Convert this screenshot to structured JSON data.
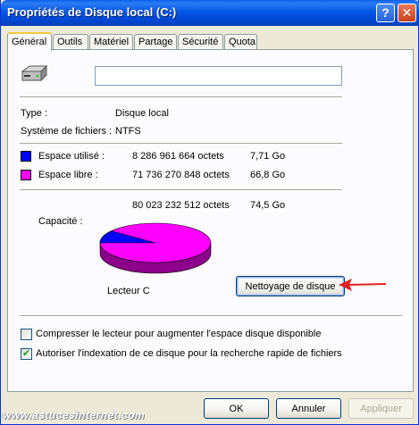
{
  "window": {
    "title": "Propriétés de Disque local (C:)"
  },
  "titlebar": {
    "help_label": "?",
    "close_label": "✕"
  },
  "tabs": [
    {
      "label": "Général",
      "active": true
    },
    {
      "label": "Outils"
    },
    {
      "label": "Matériel"
    },
    {
      "label": "Partage"
    },
    {
      "label": "Sécurité"
    },
    {
      "label": "Quota"
    }
  ],
  "drive": {
    "name_value": "",
    "icon": "hard-drive-icon"
  },
  "props": {
    "type_label": "Type :",
    "type_value": "Disque local",
    "fs_label": "Système de fichiers :",
    "fs_value": "NTFS"
  },
  "space": {
    "used_label": "Espace utilisé :",
    "used_bytes": "8 286 961 664 octets",
    "used_gb": "7,71 Go",
    "used_color": "#0000ff",
    "free_label": "Espace libre :",
    "free_bytes": "71 736 270 848 octets",
    "free_gb": "66,8 Go",
    "free_color": "#ff00ff",
    "capacity_label": "Capacité :",
    "capacity_bytes": "80 023 232 512 octets",
    "capacity_gb": "74,5 Go",
    "drive_label": "Lecteur C",
    "used_fraction": 0.1036
  },
  "cleanup_button": "Nettoyage de disque",
  "options": {
    "compress_label": "Compresser le lecteur pour augmenter l'espace disque disponible",
    "compress_checked": false,
    "index_label": "Autoriser l'indexation de ce disque pour la recherche rapide de fichiers",
    "index_checked": true
  },
  "footer": {
    "ok": "OK",
    "cancel": "Annuler",
    "apply": "Appliquer",
    "watermark": "www.astucesinternet.com"
  }
}
